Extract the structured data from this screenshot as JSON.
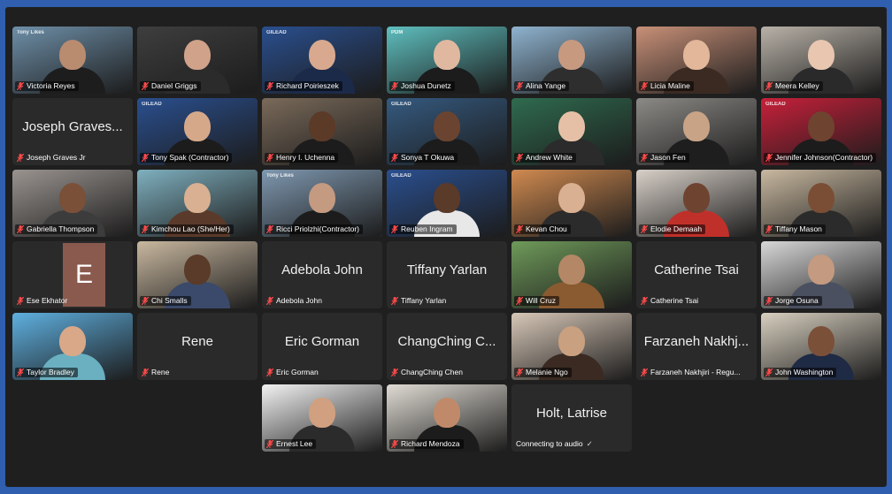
{
  "participants": [
    {
      "name": "Victoria Reyes",
      "bg": "#6e8fa8",
      "skin": "#b98b6f",
      "shirt": "#1d1d1d",
      "brand": "Tony Likes"
    },
    {
      "name": "Daniel Griggs",
      "bg": "#3e3e3e",
      "skin": "#d0a28a",
      "shirt": "#2b2b2b"
    },
    {
      "name": "Richard Poirieszek",
      "bg": "#2a4f8f",
      "skin": "#d8a98f",
      "shirt": "#1c2a4a",
      "brand": "GILEAD"
    },
    {
      "name": "Joshua Dunetz",
      "bg": "#5fbfbf",
      "skin": "#e0b8a0",
      "shirt": "#1c1c1c",
      "brand": "PDM"
    },
    {
      "name": "Alina Yange",
      "bg": "#8fb3cf",
      "skin": "#c79a80",
      "shirt": "#2e2e2e"
    },
    {
      "name": "Licia Maline",
      "bg": "#c89078",
      "skin": "#e2b79a",
      "shirt": "#3a2a22"
    },
    {
      "name": "Meera Kelley",
      "bg": "#b9b2a8",
      "skin": "#e8c6b0",
      "shirt": "#2a2a2a"
    },
    {
      "name": "Joseph Graves Jr",
      "display": "Joseph Graves..."
    },
    {
      "name": "Tony Spak (Contractor)",
      "bg": "#2a4f8f",
      "skin": "#d6a88a",
      "shirt": "#1c1c1c",
      "brand": "GILEAD"
    },
    {
      "name": "Henry I. Uchenna",
      "bg": "#7a6a5a",
      "skin": "#5b3a28",
      "shirt": "#1c1c1c"
    },
    {
      "name": "Sonya T Okuwa",
      "bg": "#355a80",
      "skin": "#6a4430",
      "shirt": "#1c1c1c",
      "brand": "GILEAD"
    },
    {
      "name": "Andrew White",
      "bg": "#2f6b4f",
      "skin": "#e6c0a6",
      "shirt": "#2b2b2b"
    },
    {
      "name": "Jason Fen",
      "bg": "#8c8a86",
      "skin": "#c9a386",
      "shirt": "#1e1e1e"
    },
    {
      "name": "Jennifer Johnson(Contractor)",
      "bg": "#c8203a",
      "skin": "#6e4330",
      "shirt": "#1c1c1c",
      "brand": "GILEAD"
    },
    {
      "name": "Gabriella Thompson",
      "bg": "#9a9490",
      "skin": "#7a5038",
      "shirt": "#3c3c3c"
    },
    {
      "name": "Kimchou Lao (She/Her)",
      "bg": "#7fb0bf",
      "skin": "#d9b092",
      "shirt": "#5a3a2a"
    },
    {
      "name": "Ricci Priolzhi(Contractor)",
      "bg": "#7f98b0",
      "skin": "#c49a80",
      "shirt": "#1c1c1c",
      "active": true,
      "brand": "Tony Likes"
    },
    {
      "name": "Reuben Ingram",
      "bg": "#2a4f8f",
      "skin": "#5a3a28",
      "shirt": "#e8e8e8",
      "brand": "GILEAD"
    },
    {
      "name": "Kevan Chou",
      "bg": "#d08a50",
      "skin": "#d9b092",
      "shirt": "#2b2b2b"
    },
    {
      "name": "Elodie Demaah",
      "bg": "#d8d0c8",
      "skin": "#6e4330",
      "shirt": "#c0302a"
    },
    {
      "name": "Tiffany Mason",
      "bg": "#c8b8a0",
      "skin": "#7a4e34",
      "shirt": "#2b2b2b"
    },
    {
      "name": "Ese Ekhator",
      "initial": "E"
    },
    {
      "name": "Chi Smalls",
      "bg": "#c9b8a0",
      "skin": "#5a3a28",
      "shirt": "#3b4a6a"
    },
    {
      "name": "Adebola John",
      "display": "Adebola John"
    },
    {
      "name": "Tiffany Yarlan",
      "display": "Tiffany Yarlan"
    },
    {
      "name": "Will Cruz",
      "bg": "#6f9a5a",
      "skin": "#b48866",
      "shirt": "#8a5a30"
    },
    {
      "name": "Catherine Tsai",
      "display": "Catherine Tsai"
    },
    {
      "name": "Jorge Osuna",
      "bg": "#d8d8d8",
      "skin": "#c49a80",
      "shirt": "#4a5060"
    },
    {
      "name": "Taylor Bradley",
      "bg": "#5fb0e0",
      "skin": "#d9a888",
      "shirt": "#6ab0c0"
    },
    {
      "name": "Rene",
      "display": "Rene"
    },
    {
      "name": "Eric Gorman",
      "display": "Eric Gorman"
    },
    {
      "name": "ChangChing Chen",
      "display": "ChangChing C..."
    },
    {
      "name": "Melanie Ngo",
      "bg": "#d8c8b8",
      "skin": "#c9a080",
      "shirt": "#3a2a22"
    },
    {
      "name": "Farzaneh Nakhjiri - Regu...",
      "display": "Farzaneh Nakhj..."
    },
    {
      "name": "John Washington",
      "bg": "#d8d0c0",
      "skin": "#7a5038",
      "shirt": "#1f2a44"
    },
    {
      "blank": true
    },
    {
      "blank": true
    },
    {
      "name": "Ernest Lee",
      "bg": "#f2f2f2",
      "skin": "#d0a080",
      "shirt": "#2b2b2b"
    },
    {
      "name": "Richard Mendoza",
      "bg": "#e0dcd4",
      "skin": "#c08a6a",
      "shirt": "#1c1c1c"
    },
    {
      "name": "Connecting to audio",
      "display": "Holt, Latrise",
      "connecting": true,
      "check": "✓"
    }
  ]
}
